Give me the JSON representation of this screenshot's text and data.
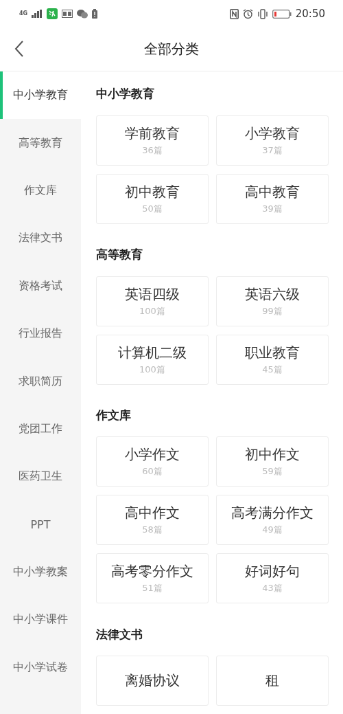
{
  "status_bar": {
    "network": "4G",
    "time": "20:50"
  },
  "header": {
    "title": "全部分类"
  },
  "sidebar": {
    "items": [
      {
        "label": "中小学教育",
        "selected": true
      },
      {
        "label": "高等教育",
        "selected": false
      },
      {
        "label": "作文库",
        "selected": false
      },
      {
        "label": "法律文书",
        "selected": false
      },
      {
        "label": "资格考试",
        "selected": false
      },
      {
        "label": "行业报告",
        "selected": false
      },
      {
        "label": "求职简历",
        "selected": false
      },
      {
        "label": "党团工作",
        "selected": false
      },
      {
        "label": "医药卫生",
        "selected": false
      },
      {
        "label": "PPT",
        "selected": false
      },
      {
        "label": "中小学教案",
        "selected": false
      },
      {
        "label": "中小学课件",
        "selected": false
      },
      {
        "label": "中小学试卷",
        "selected": false
      }
    ]
  },
  "sections": [
    {
      "title": "中小学教育",
      "cards": [
        {
          "name": "学前教育",
          "count": "36篇"
        },
        {
          "name": "小学教育",
          "count": "37篇"
        },
        {
          "name": "初中教育",
          "count": "50篇"
        },
        {
          "name": "高中教育",
          "count": "39篇"
        }
      ]
    },
    {
      "title": "高等教育",
      "cards": [
        {
          "name": "英语四级",
          "count": "100篇"
        },
        {
          "name": "英语六级",
          "count": "99篇"
        },
        {
          "name": "计算机二级",
          "count": "100篇"
        },
        {
          "name": "职业教育",
          "count": "45篇"
        }
      ]
    },
    {
      "title": "作文库",
      "cards": [
        {
          "name": "小学作文",
          "count": "60篇"
        },
        {
          "name": "初中作文",
          "count": "59篇"
        },
        {
          "name": "高中作文",
          "count": "58篇"
        },
        {
          "name": "高考满分作文",
          "count": "49篇"
        },
        {
          "name": "高考零分作文",
          "count": "51篇"
        },
        {
          "name": "好词好句",
          "count": "43篇"
        }
      ]
    },
    {
      "title": "法律文书",
      "cards": [
        {
          "name": "离婚协议"
        },
        {
          "name": "租"
        }
      ]
    }
  ]
}
